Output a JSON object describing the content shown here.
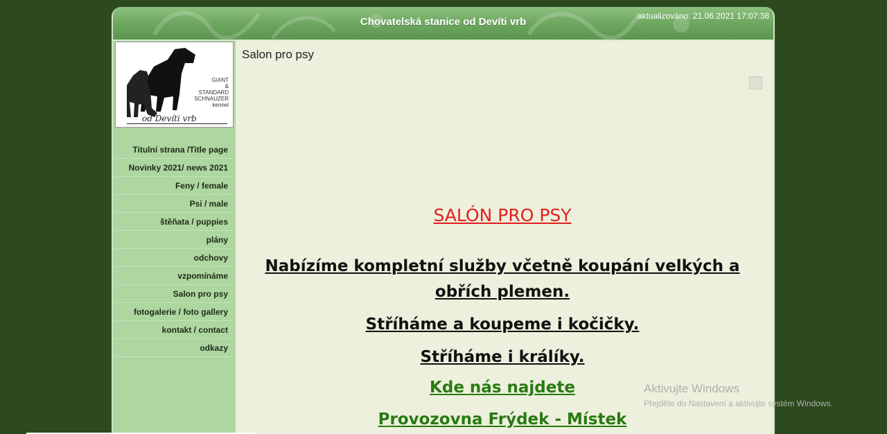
{
  "header": {
    "site_title": "Chovatelská stanice od Devíti vrb",
    "updated": "aktualizováno: 21.06.2021 17:07:38"
  },
  "logo": {
    "label_lines": [
      "GIANT",
      "&",
      "STANDARD",
      "SCHNAUZER",
      "kennel"
    ],
    "script": "od Devíti vrb"
  },
  "nav": {
    "items": [
      {
        "label": "Titulní strana /Title page"
      },
      {
        "label": "Novinky 2021/ news 2021"
      },
      {
        "label": "Feny / female"
      },
      {
        "label": "Psi / male"
      },
      {
        "label": "štěňata / puppies"
      },
      {
        "label": "plány"
      },
      {
        "label": "odchovy"
      },
      {
        "label": "vzpomínáme"
      },
      {
        "label": "Salon pro psy"
      },
      {
        "label": "fotogalerie / foto gallery"
      },
      {
        "label": "kontakt / contact"
      },
      {
        "label": "odkazy"
      }
    ]
  },
  "content": {
    "page_title": "Salon pro psy",
    "heading": "SALÓN PRO PSY",
    "line1": "Nabízíme kompletní služby včetně koupání velkých a obřích plemen.",
    "line2": "Stříháme a koupeme i kočičky.",
    "line3": "Stříháme i králíky.",
    "line4": "Kde nás najdete",
    "line5": "Provozovna Frýdek - Místek"
  },
  "watermark": {
    "title": "Aktivujte Windows",
    "subtitle": "Přejděte do Nastavení a aktivujte systém Windows."
  },
  "colors": {
    "background": "#2d4a1f",
    "sidebar": "#aed6a0",
    "header": "#6ea760",
    "content_bg": "#edf0dd",
    "heading_red": "#e31e1e",
    "link_green": "#287a12"
  }
}
